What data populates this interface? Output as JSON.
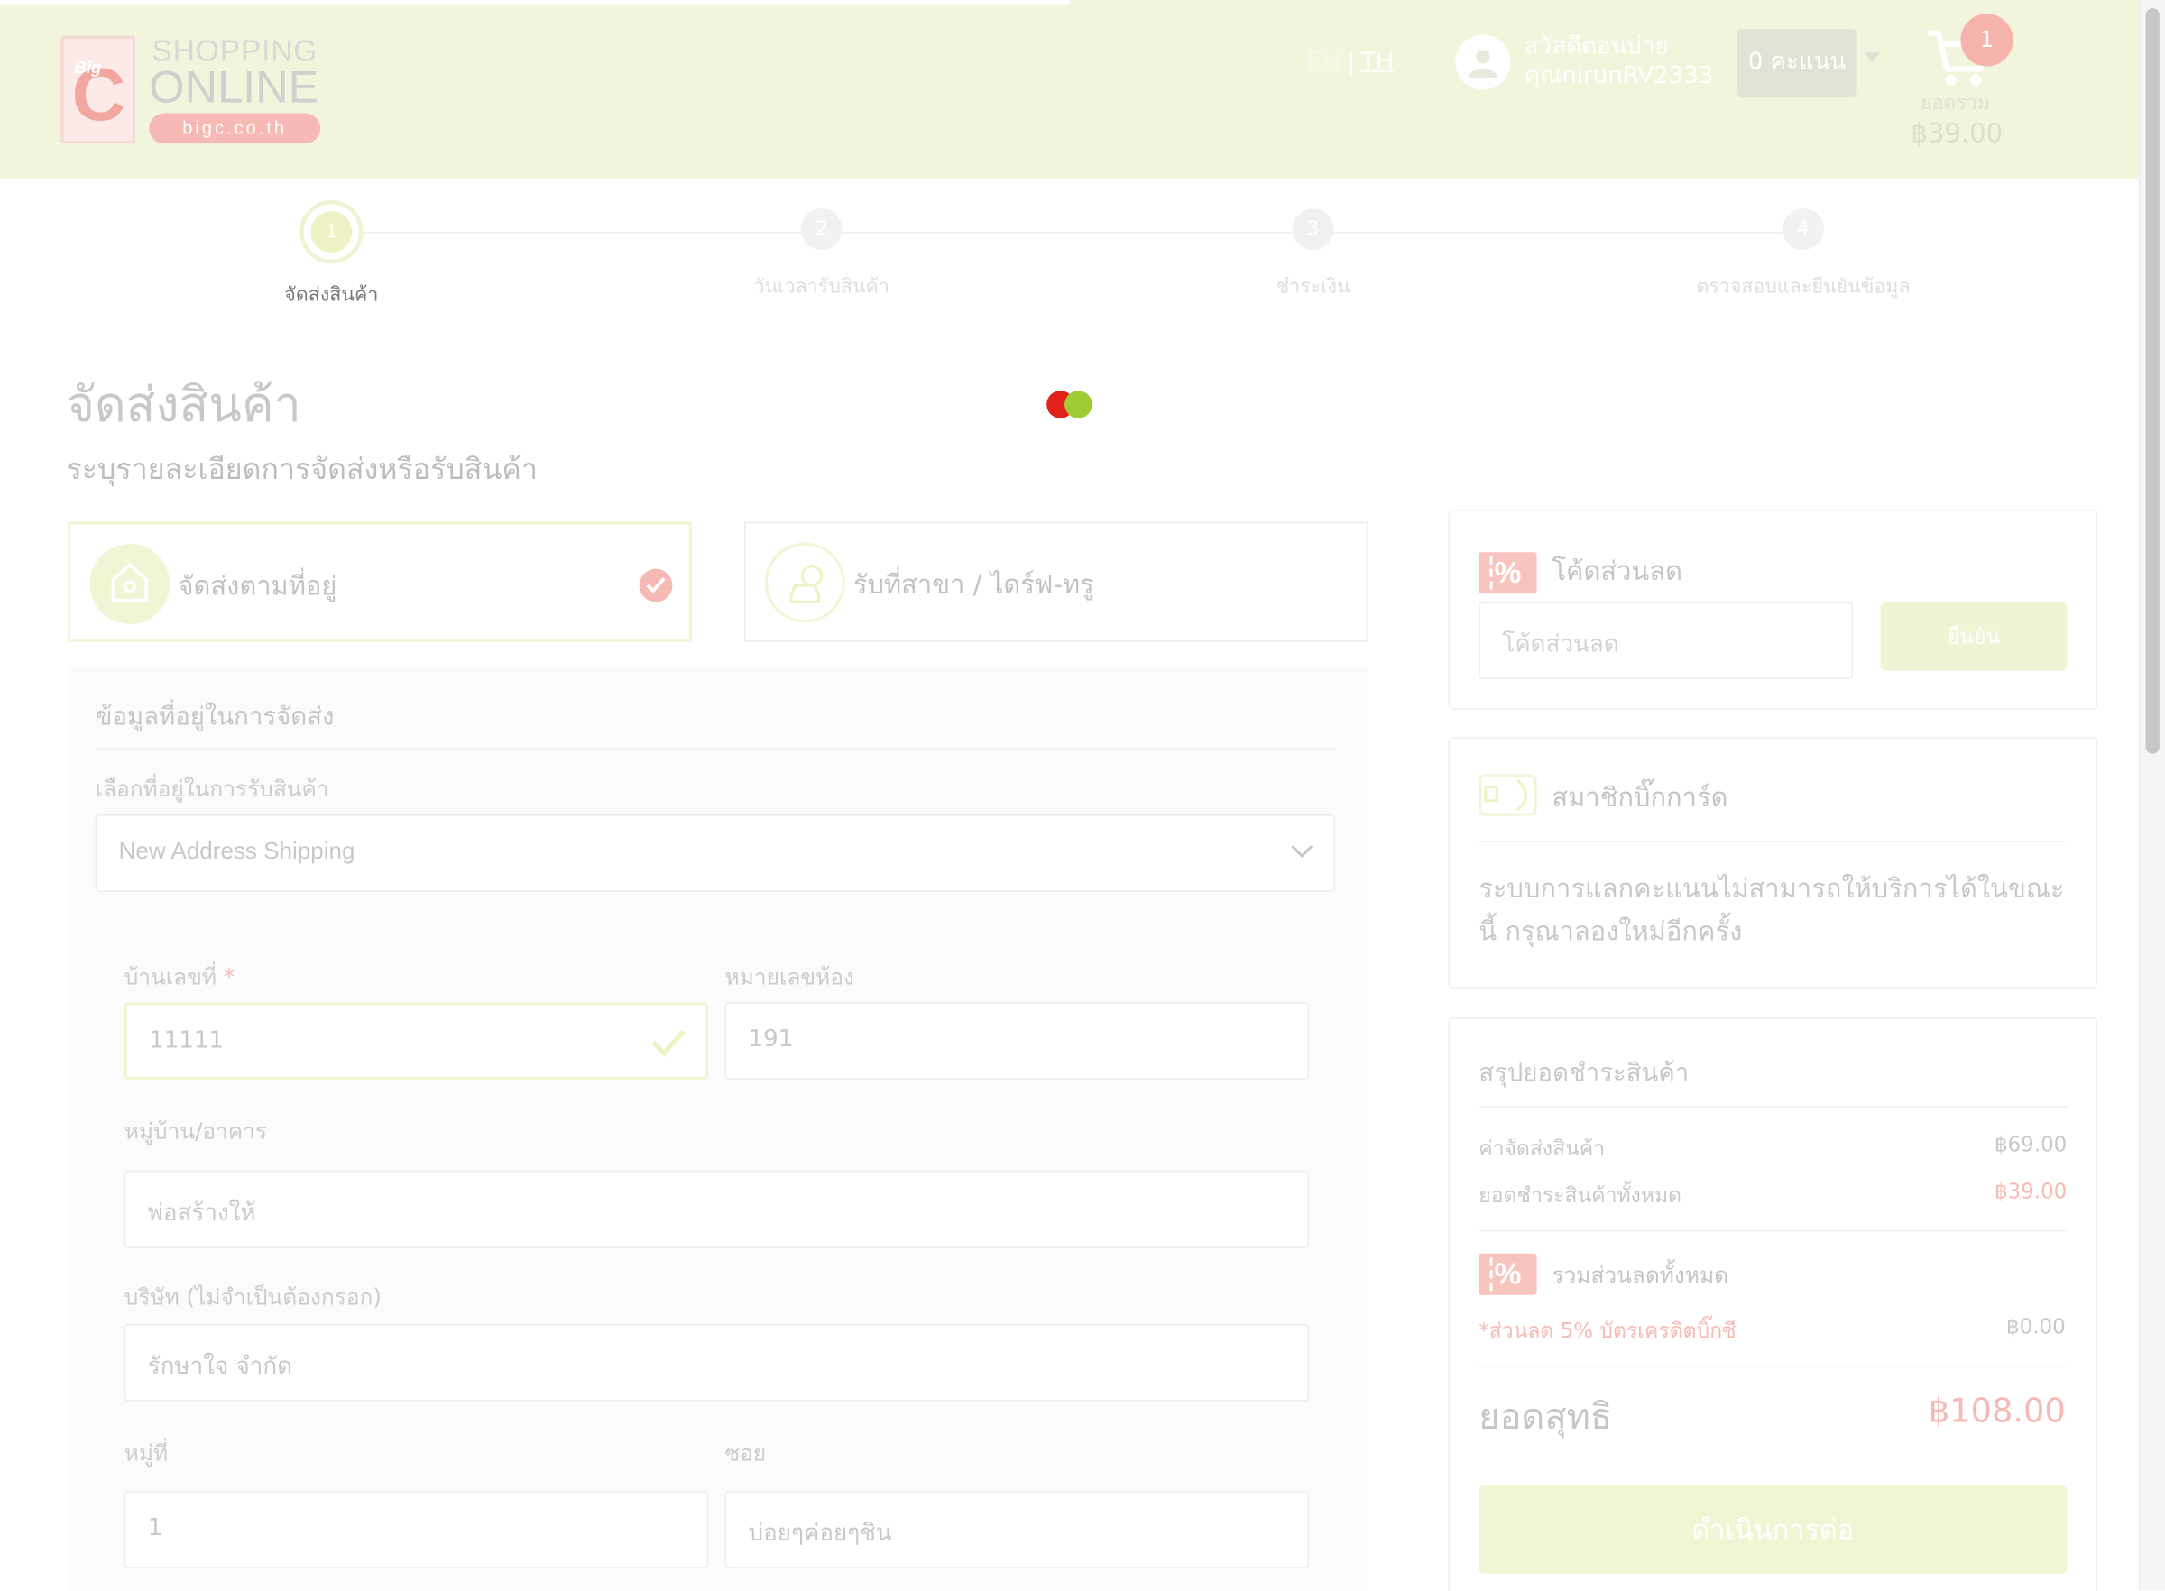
{
  "header": {
    "logo": {
      "big": "Big",
      "c": "C",
      "shopping": "SHOPPING",
      "online": "ONLINE",
      "site": "bigc.co.th"
    },
    "lang": {
      "en": "EN",
      "sep": "|",
      "th": "TH"
    },
    "greeting_line1": "สวัสดีตอนบ่าย",
    "greeting_line2": "คุณnirunRV2333",
    "points_label": "0 คะแนน",
    "cart": {
      "badge": "1",
      "label": "ยอดรวม",
      "total": "฿39.00"
    }
  },
  "steps": [
    {
      "num": "1",
      "label": "จัดส่งสินค้า",
      "active": true
    },
    {
      "num": "2",
      "label": "วันเวลารับสินค้า",
      "active": false
    },
    {
      "num": "3",
      "label": "ชำระเงิน",
      "active": false
    },
    {
      "num": "4",
      "label": "ตรวจสอบและยืนยันข้อมูล",
      "active": false
    }
  ],
  "page": {
    "title": "จัดส่งสินค้า",
    "subtitle": "ระบุรายละเอียดการจัดส่งหรือรับสินค้า"
  },
  "delivery_options": [
    {
      "label": "จัดส่งตามที่อยู่",
      "selected": true
    },
    {
      "label": "รับที่สาขา / ไดร์ฟ-ทรู",
      "selected": false
    }
  ],
  "form": {
    "section_title": "ข้อมูลที่อยู่ในการจัดส่ง",
    "address_select_label": "เลือกที่อยู่ในการรับสินค้า",
    "address_select_value": "New Address Shipping",
    "house_no_label": "บ้านเลขที่",
    "required_mark": "*",
    "house_no_value": "11111",
    "room_no_label": "หมายเลขห้อง",
    "room_no_value": "191",
    "village_label": "หมู่บ้าน/อาคาร",
    "village_value": "พ่อสร้างให้",
    "company_label": "บริษัท (ไม่จำเป็นต้องกรอก)",
    "company_value": "รักษาใจ จำกัด",
    "moo_label": "หมู่ที่",
    "moo_value": "1",
    "soi_label": "ซอย",
    "soi_value": "บ่อยๆค่อยๆชิน"
  },
  "coupon": {
    "icon_text": "%",
    "title": "โค้ดส่วนลด",
    "placeholder": "โค้ดส่วนลด",
    "button": "ยืนยัน"
  },
  "bigcard": {
    "title": "สมาชิกบิ๊กการ์ด",
    "message": "ระบบการแลกคะแนนไม่สามารถให้บริการได้ในขณะนี้ กรุณาลองใหม่อีกครั้ง"
  },
  "summary": {
    "title": "สรุปยอดชำระสินค้า",
    "shipping_label": "ค่าจัดส่งสินค้า",
    "shipping_value": "฿69.00",
    "items_label": "ยอดชำระสินค้าทั้งหมด",
    "items_value": "฿39.00",
    "discount_title": "รวมส่วนลดทั้งหมด",
    "discount_note": "*ส่วนลด 5% บัตรเครดิตบิ๊กซี",
    "discount_value": "฿0.00",
    "net_label": "ยอดสุทธิ",
    "net_value": "฿108.00",
    "continue_button": "ดำเนินการต่อ"
  },
  "colors": {
    "header_bg": "#f2f4db",
    "accent_green": "#9fcc34",
    "accent_red": "#e0201a",
    "accent_pink": "#f6b9b3"
  }
}
